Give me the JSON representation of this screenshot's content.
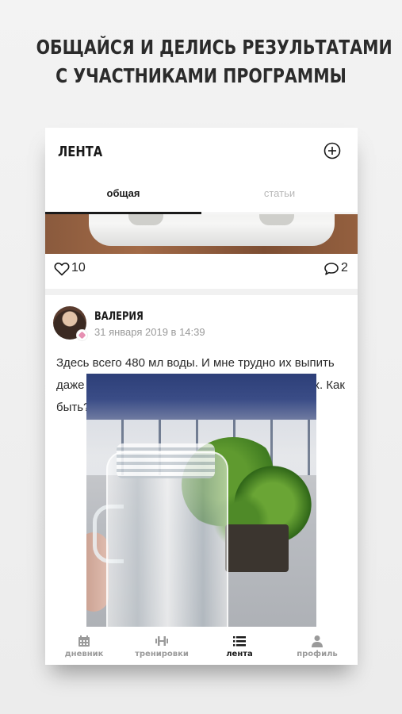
{
  "promo": {
    "line1": "ОБЩАЙСЯ И ДЕЛИСЬ РЕЗУЛЬТАТАМИ",
    "line2": "С УЧАСТНИКАМИ ПРОГРАММЫ"
  },
  "header": {
    "title": "ЛЕНТА",
    "add_icon": "plus-circle-icon"
  },
  "tabs": [
    {
      "label": "общая",
      "active": true
    },
    {
      "label": "статьи",
      "active": false
    }
  ],
  "previous_post": {
    "likes": "10",
    "comments": "2"
  },
  "post": {
    "author": "ВАЛЕРИЯ",
    "date": "31 января 2019 в 14:39",
    "text": "Здесь всего 480 мл воды. И мне трудно их выпить даже в течении дня,не говоря уже о 2 -х литрах. Как быть? Поделитесь секретами, как ..."
  },
  "bottom_nav": [
    {
      "label": "дневник",
      "icon": "calendar-icon",
      "active": false
    },
    {
      "label": "тренировки",
      "icon": "dumbbell-icon",
      "active": false
    },
    {
      "label": "лента",
      "icon": "list-icon",
      "active": true
    },
    {
      "label": "профиль",
      "icon": "person-icon",
      "active": false
    }
  ],
  "colors": {
    "text": "#1a1a1a",
    "muted": "#9a9a9a",
    "inactive_tab": "#b8b8b8"
  }
}
